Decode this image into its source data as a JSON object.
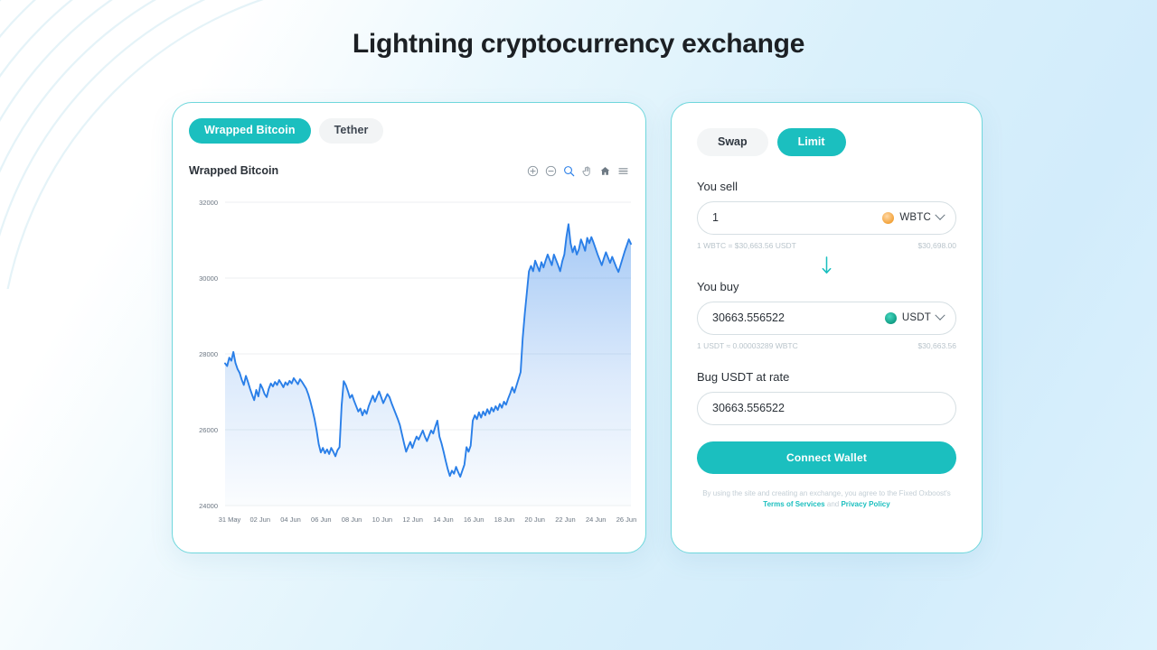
{
  "page": {
    "title": "Lightning cryptocurrency exchange",
    "accent_color": "#1bbfbf",
    "chart_line_color": "#2a7fe8",
    "background": "light blue gradient"
  },
  "chart_card": {
    "asset_tabs": [
      {
        "label": "Wrapped Bitcoin",
        "active": true
      },
      {
        "label": "Tether",
        "active": false
      }
    ],
    "chart_title": "Wrapped Bitcoin",
    "toolbar": [
      {
        "name": "zoom-in-icon",
        "label": "Zoom In"
      },
      {
        "name": "zoom-out-icon",
        "label": "Zoom Out"
      },
      {
        "name": "selection-zoom-icon",
        "label": "Selection Zoom",
        "active": true
      },
      {
        "name": "panning-icon",
        "label": "Panning"
      },
      {
        "name": "reset-zoom-icon",
        "label": "Reset Zoom"
      },
      {
        "name": "menu-icon",
        "label": "Menu"
      }
    ]
  },
  "chart_data": {
    "type": "area",
    "title": "Wrapped Bitcoin",
    "xlabel": "",
    "ylabel": "",
    "ylim": [
      24000,
      32000
    ],
    "yticks": [
      24000,
      26000,
      28000,
      30000,
      32000
    ],
    "ytick_labels": [
      "24000",
      "26000",
      "28000",
      "30000",
      "32000"
    ],
    "grid": true,
    "legend": "none",
    "xtick_labels": [
      "31 May",
      "02 Jun",
      "04 Jun",
      "06 Jun",
      "08 Jun",
      "10 Jun",
      "12 Jun",
      "14 Jun",
      "16 Jun",
      "18 Jun",
      "20 Jun",
      "22 Jun",
      "24 Jun",
      "26 Jun"
    ],
    "series": [
      {
        "name": "Wrapped Bitcoin",
        "color": "#2a7fe8",
        "values": [
          27750,
          27680,
          27900,
          27820,
          28050,
          27760,
          27600,
          27500,
          27320,
          27180,
          27420,
          27260,
          27080,
          26920,
          26780,
          27050,
          26880,
          27200,
          27090,
          26940,
          26860,
          27080,
          27220,
          27140,
          27260,
          27180,
          27310,
          27220,
          27120,
          27250,
          27180,
          27290,
          27220,
          27360,
          27280,
          27200,
          27330,
          27260,
          27170,
          27080,
          26930,
          26740,
          26520,
          26280,
          25980,
          25620,
          25400,
          25520,
          25380,
          25480,
          25360,
          25520,
          25420,
          25300,
          25460,
          25540,
          26640,
          27280,
          27180,
          27020,
          26840,
          26920,
          26760,
          26620,
          26480,
          26560,
          26380,
          26520,
          26420,
          26620,
          26760,
          26900,
          26740,
          26880,
          27010,
          26860,
          26700,
          26820,
          26940,
          26860,
          26700,
          26560,
          26420,
          26280,
          26120,
          25880,
          25640,
          25420,
          25560,
          25680,
          25520,
          25680,
          25820,
          25740,
          25860,
          25980,
          25820,
          25700,
          25840,
          25980,
          25900,
          26080,
          26240,
          25820,
          25640,
          25420,
          25180,
          24960,
          24780,
          24920,
          24840,
          25020,
          24880,
          24760,
          24920,
          25080,
          25540,
          25420,
          25580,
          26240,
          26380,
          26280,
          26460,
          26320,
          26480,
          26380,
          26540,
          26420,
          26580,
          26480,
          26620,
          26520,
          26680,
          26580,
          26740,
          26660,
          26820,
          26960,
          27120,
          26980,
          27160,
          27340,
          27520,
          28420,
          29060,
          29620,
          30180,
          30320,
          30180,
          30460,
          30320,
          30180,
          30420,
          30280,
          30460,
          30620,
          30480,
          30340,
          30620,
          30480,
          30340,
          30180,
          30440,
          30620,
          31080,
          31420,
          30920,
          30680,
          30840,
          30620,
          30760,
          31020,
          30880,
          30720,
          31060,
          30920,
          31080,
          30940,
          30780,
          30620,
          30480,
          30340,
          30520,
          30680,
          30540,
          30400,
          30560,
          30420,
          30280,
          30160,
          30340,
          30520,
          30700,
          30860,
          31020,
          30900
        ]
      }
    ]
  },
  "trade_panel": {
    "mode_tabs": [
      {
        "label": "Swap",
        "active": false
      },
      {
        "label": "Limit",
        "active": true
      }
    ],
    "sell": {
      "label": "You sell",
      "value": "1",
      "placeholder": "0",
      "token": "WBTC",
      "token_icon": "wbtc-coin-icon",
      "rate_note": "1 WBTC = $30,663.56 USDT",
      "fiat_value": "$30,698.00"
    },
    "swap_direction_icon": "arrow-down-icon",
    "buy": {
      "label": "You buy",
      "value": "30663.556522",
      "placeholder": "0",
      "token": "USDT",
      "token_icon": "usdt-coin-icon",
      "rate_note": "1 USDT ≈ 0.00003289 WBTC",
      "fiat_value": "$30,663.56"
    },
    "rate": {
      "label": "Bug USDT at rate",
      "value": "30663.556522",
      "placeholder": "0"
    },
    "connect_button": "Connect Wallet",
    "disclaimer": {
      "text_before": "By using the site and creating an exchange, you agree to the Fixed Oxboost's ",
      "terms_link": "Terms of Services",
      "text_middle": " and ",
      "privacy_link": "Privacy Policy"
    }
  }
}
